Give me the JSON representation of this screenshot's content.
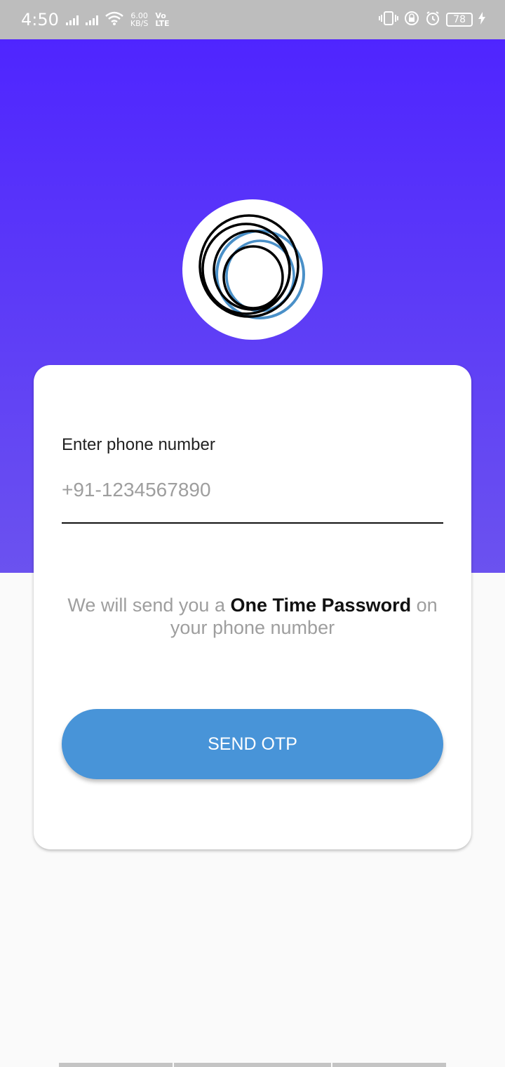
{
  "status_bar": {
    "time": "4:50",
    "speed_value": "6.00",
    "speed_unit": "KB/S",
    "volte_top": "Vo",
    "volte_bottom": "LTE",
    "battery": "78"
  },
  "colors": {
    "hero_top": "#4f25ff",
    "hero_bottom": "#6b52ef",
    "button": "#4894d8",
    "logo_ring_blue": "#4a90c8"
  },
  "logo": {
    "icon": "circles-logo-icon"
  },
  "form": {
    "label": "Enter phone number",
    "placeholder": "+91-1234567890",
    "value": ""
  },
  "info": {
    "prefix": "We will send you a ",
    "bold": "One Time Password",
    "suffix": " on your phone number"
  },
  "send_button": {
    "label": "SEND OTP"
  }
}
